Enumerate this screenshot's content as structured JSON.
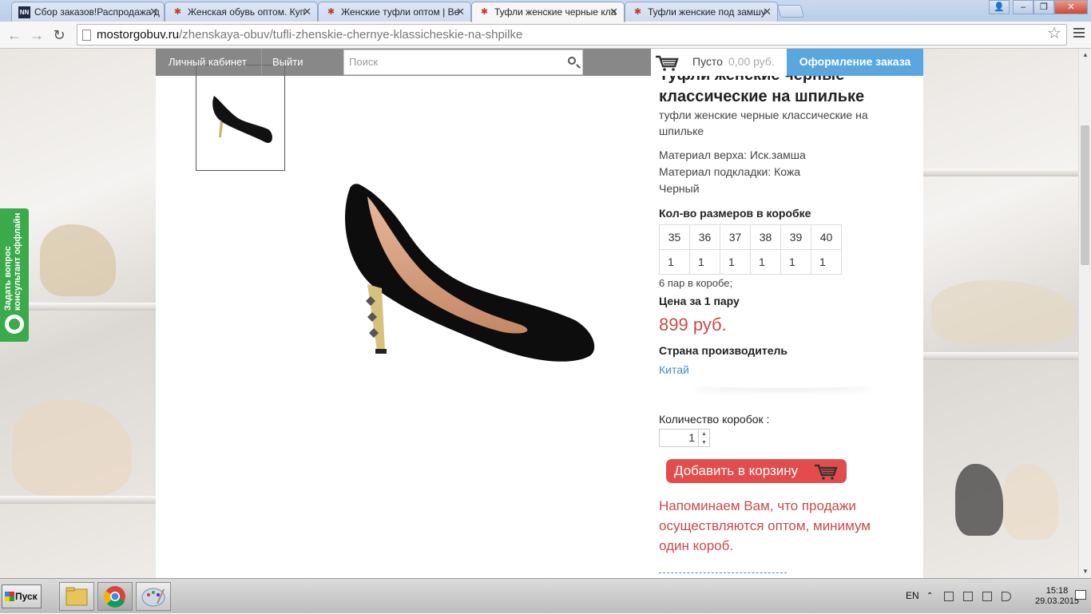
{
  "browser": {
    "tabs": [
      {
        "title": "Сбор заказов!Распродажа д",
        "icon": "nn-favicon"
      },
      {
        "title": "Женская обувь оптом. Куп",
        "icon": "site-favicon"
      },
      {
        "title": "Женские туфли оптом | Ве",
        "icon": "site-favicon"
      },
      {
        "title": "Туфли женские черные кла",
        "icon": "site-favicon",
        "active": true
      },
      {
        "title": "Туфли женские под замшу",
        "icon": "site-favicon"
      }
    ],
    "url_host": "mostorgobuv.ru",
    "url_path": "/zhenskaya-obuv/tufli-zhenskie-chernye-klassicheskie-na-shpilke"
  },
  "header": {
    "account_link": "Личный кабинет",
    "logout_link": "Выйти",
    "search_placeholder": "Поиск",
    "cart_status": "Пусто",
    "cart_total": "0,00 руб.",
    "checkout_label": "Оформление заказа"
  },
  "side_widget": {
    "line1": "Задать вопрос",
    "line2": "консультант оффлайн"
  },
  "product": {
    "title": "Туфли женские черные классические на шпильке",
    "subtitle": "туфли женские черные классические на шпильке",
    "material_top": "Материал верха: Иск.замша",
    "material_lining": "Материал подкладки: Кожа",
    "color": "Черный",
    "sizes_label": "Кол-во размеров в коробке",
    "sizes": [
      "35",
      "36",
      "37",
      "38",
      "39",
      "40"
    ],
    "counts": [
      "1",
      "1",
      "1",
      "1",
      "1",
      "1"
    ],
    "pairs_in_box": "6 пар в коробе;",
    "price_label": "Цена за 1 пару",
    "price": "899 руб.",
    "country_label": "Страна производитель",
    "country": "Китай",
    "qty_label": "Количество коробок :",
    "qty_value": "1",
    "add_to_cart": "Добавить в корзину",
    "notice": "Напоминаем Вам, что продажи осуществляются оптом, минимум один короб."
  },
  "taskbar": {
    "start_label": "Пуск",
    "language": "EN",
    "time": "15:18",
    "date": "29.03.2015"
  },
  "colors": {
    "accent_red": "#e24c4c",
    "price_red": "#c94a4a",
    "link_blue": "#3a8fd0",
    "checkout_blue": "#5aa7e0",
    "widget_green": "#3aaa4a"
  }
}
